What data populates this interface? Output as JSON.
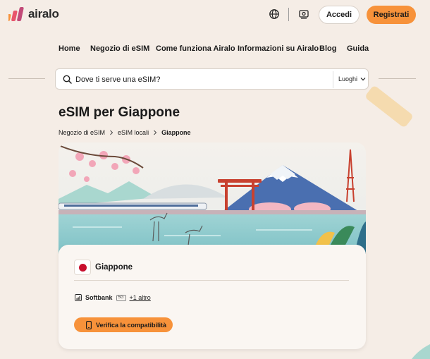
{
  "header": {
    "logo_text": "airalo",
    "login_label": "Accedi",
    "register_label": "Registrati",
    "icons": [
      "globe-icon",
      "currency-icon"
    ]
  },
  "nav": {
    "items": [
      {
        "label": "Home"
      },
      {
        "label": "Negozio di eSIM"
      },
      {
        "label": "Come funziona Airalo"
      },
      {
        "label": "Informazioni su Airalo"
      },
      {
        "label": "Blog"
      },
      {
        "label": "Guida"
      }
    ]
  },
  "search": {
    "placeholder": "Dove ti serve una eSIM?",
    "places_label": "Luoghi"
  },
  "page": {
    "title": "eSIM per Giappone"
  },
  "breadcrumb": {
    "items": [
      "Negozio di eSIM",
      "eSIM locali",
      "Giappone"
    ]
  },
  "card": {
    "country": "Giappone",
    "network": "Softbank",
    "network_badge": "5G",
    "more_networks": "+1 altro",
    "verify_label": "Verifica la compatibilità"
  },
  "colors": {
    "background": "#f5ede6",
    "accent": "#f7923a",
    "flag_red": "#c8102e"
  }
}
